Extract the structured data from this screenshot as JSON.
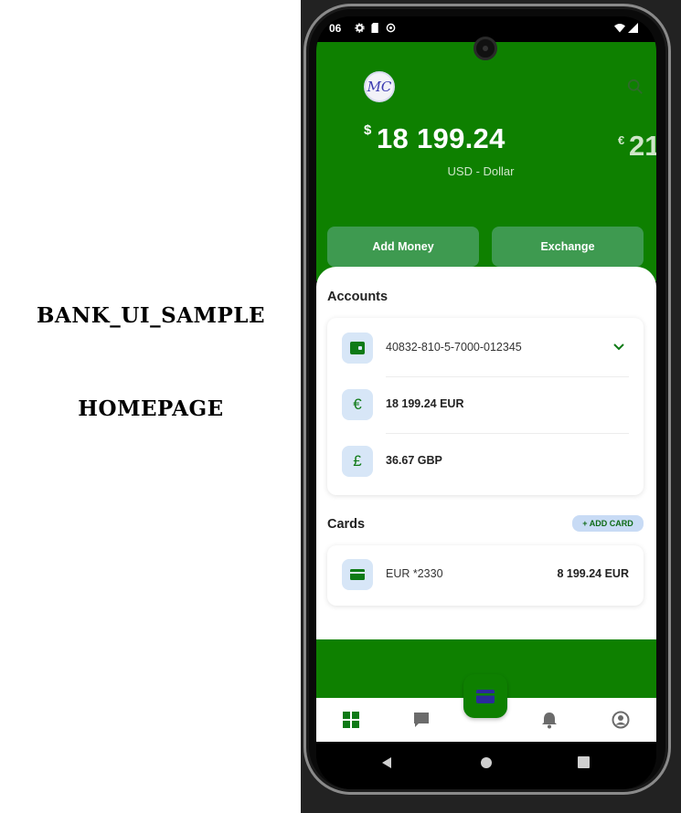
{
  "captions": {
    "app": "BANK_UI_SAMPLE",
    "page": "HOMEPAGE"
  },
  "status": {
    "time": "06"
  },
  "header": {
    "avatar_text": "MC"
  },
  "balance": {
    "currency_symbol": "$",
    "amount": "18 199.24",
    "label": "USD - Dollar",
    "next_currency_symbol": "€",
    "next_amount_partial": "21"
  },
  "actions": {
    "add_money": "Add Money",
    "exchange": "Exchange"
  },
  "accounts": {
    "title": "Accounts",
    "items": [
      {
        "icon": "wallet-icon",
        "text": "40832-810-5-7000-012345"
      },
      {
        "icon": "euro-icon",
        "symbol": "€",
        "text": "18 199.24 EUR"
      },
      {
        "icon": "pound-icon",
        "symbol": "£",
        "text": "36.67 GBP"
      }
    ]
  },
  "cards": {
    "title": "Cards",
    "add_label": "+ ADD CARD",
    "items": [
      {
        "icon": "credit-card-icon",
        "name": "EUR *2330",
        "amount": "8 199.24 EUR"
      }
    ]
  },
  "tabbar": {
    "tabs": [
      "dashboard-icon",
      "chat-icon",
      "card-icon",
      "bell-icon",
      "account-icon"
    ],
    "active_color": "#0e7a16",
    "inactive_color": "#6b6b6b"
  },
  "colors": {
    "brand_green": "#0e8000",
    "button_green": "#3e9a50",
    "icon_bg": "#d7e6f7"
  }
}
